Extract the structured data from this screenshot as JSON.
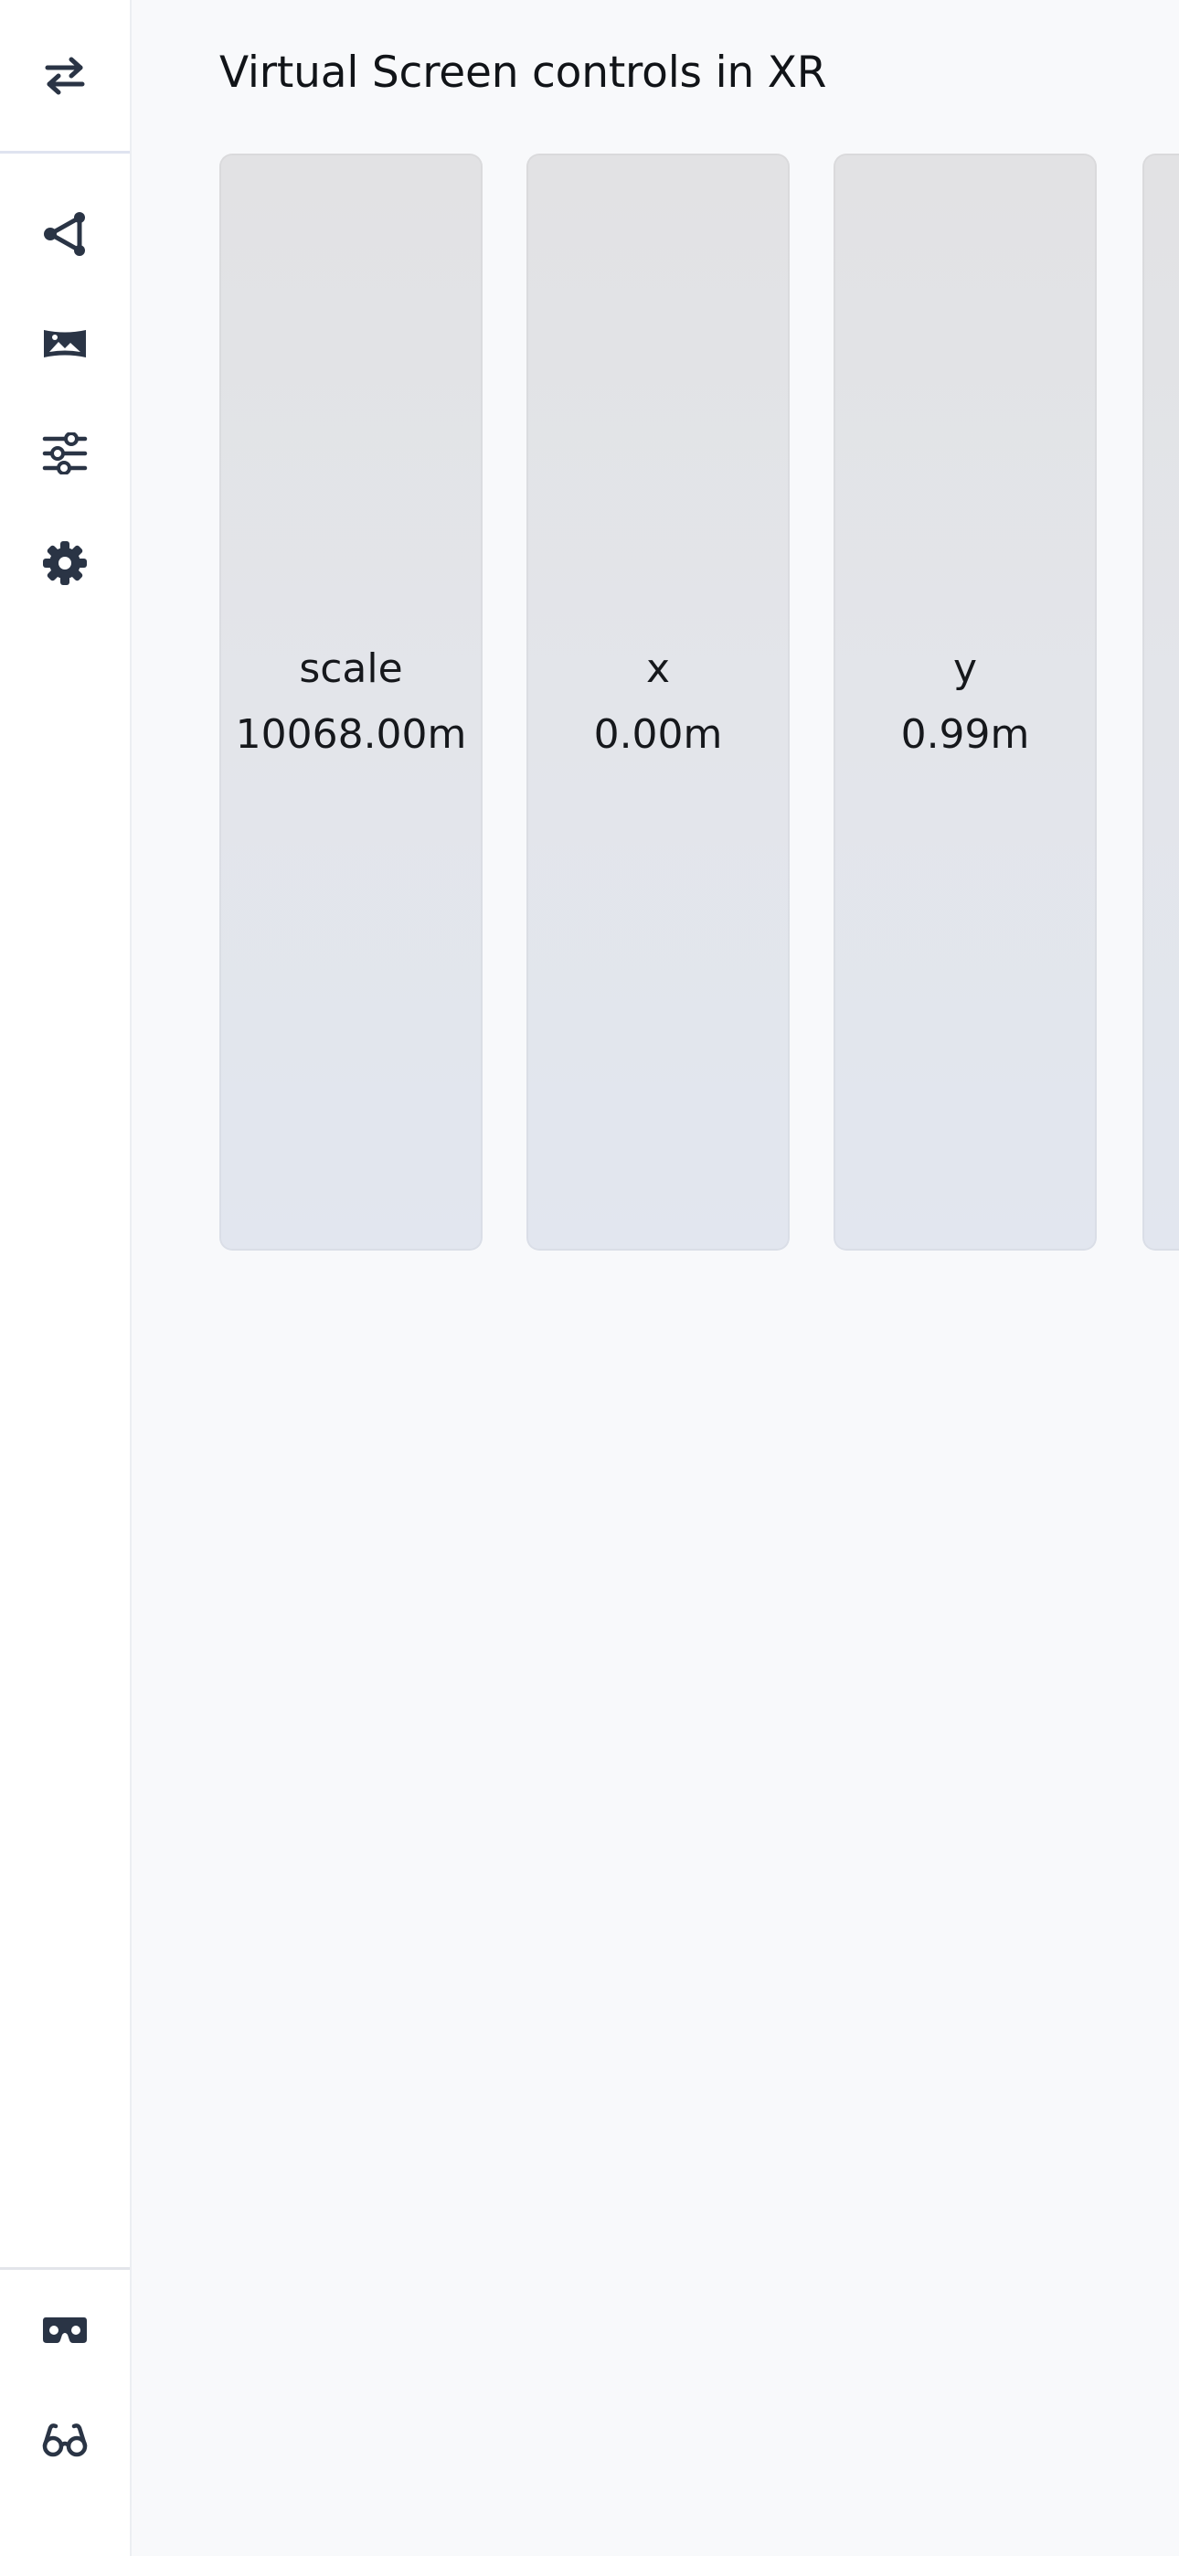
{
  "sidebar": {
    "top_button": {
      "icon": "swap-arrows-icon"
    },
    "nav_items": [
      {
        "icon": "share-nodes-icon"
      },
      {
        "icon": "image-panorama-icon"
      },
      {
        "icon": "sliders-icon"
      },
      {
        "icon": "gear-icon"
      }
    ],
    "bottom_items": [
      {
        "icon": "vr-headset-icon"
      },
      {
        "icon": "glasses-icon"
      }
    ]
  },
  "main": {
    "title": "Virtual Screen controls in XR",
    "controls": [
      {
        "label": "scale",
        "value": "10068.00m"
      },
      {
        "label": "x",
        "value": "0.00m"
      },
      {
        "label": "y",
        "value": "0.99m"
      },
      {
        "label": "",
        "value": ""
      }
    ]
  },
  "colors": {
    "icon": "#2a3445",
    "background": "#f8f9fb",
    "sidebar": "#ffffff",
    "card": "#e3e5ea"
  }
}
